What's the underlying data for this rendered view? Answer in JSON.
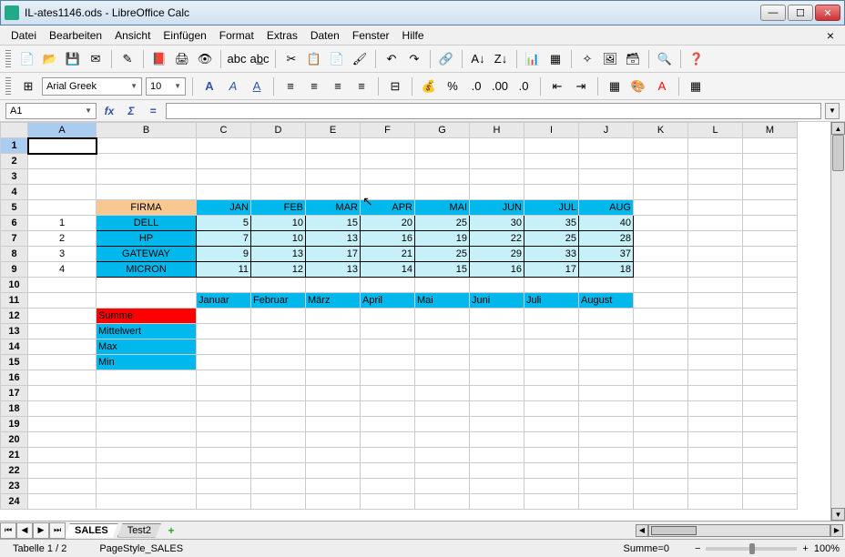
{
  "window": {
    "title": "IL-ates1146.ods - LibreOffice Calc"
  },
  "menu": {
    "items": [
      "Datei",
      "Bearbeiten",
      "Ansicht",
      "Einfügen",
      "Format",
      "Extras",
      "Daten",
      "Fenster",
      "Hilfe"
    ]
  },
  "font": {
    "name": "Arial Greek",
    "size": "10"
  },
  "cellref": "A1",
  "columns": [
    "A",
    "B",
    "C",
    "D",
    "E",
    "F",
    "G",
    "H",
    "I",
    "J",
    "K",
    "L",
    "M"
  ],
  "table": {
    "firma_label": "FIRMA",
    "months": [
      "JAN",
      "FEB",
      "MAR",
      "APR",
      "MAI",
      "JUN",
      "JUL",
      "AUG"
    ],
    "rows": [
      {
        "n": "1",
        "company": "DELL",
        "vals": [
          "5",
          "10",
          "15",
          "20",
          "25",
          "30",
          "35",
          "40"
        ]
      },
      {
        "n": "2",
        "company": "HP",
        "vals": [
          "7",
          "10",
          "13",
          "16",
          "19",
          "22",
          "25",
          "28"
        ]
      },
      {
        "n": "3",
        "company": "GATEWAY",
        "vals": [
          "9",
          "13",
          "17",
          "21",
          "25",
          "29",
          "33",
          "37"
        ]
      },
      {
        "n": "4",
        "company": "MICRON",
        "vals": [
          "11",
          "12",
          "13",
          "14",
          "15",
          "16",
          "17",
          "18"
        ]
      }
    ],
    "months_long": [
      "Januar",
      "Februar",
      "März",
      "April",
      "Mai",
      "Juni",
      "Juli",
      "August"
    ],
    "stats": [
      "Summe",
      "Mittelwert",
      "Max",
      "Min"
    ]
  },
  "tabs": {
    "items": [
      "SALES",
      "Test2"
    ],
    "active": 0
  },
  "status": {
    "sheet": "Tabelle 1 / 2",
    "style": "PageStyle_SALES",
    "sum": "Summe=0",
    "zoom": "100%"
  },
  "chart_data": {
    "type": "table",
    "categories": [
      "JAN",
      "FEB",
      "MAR",
      "APR",
      "MAI",
      "JUN",
      "JUL",
      "AUG"
    ],
    "series": [
      {
        "name": "DELL",
        "values": [
          5,
          10,
          15,
          20,
          25,
          30,
          35,
          40
        ]
      },
      {
        "name": "HP",
        "values": [
          7,
          10,
          13,
          16,
          19,
          22,
          25,
          28
        ]
      },
      {
        "name": "GATEWAY",
        "values": [
          9,
          13,
          17,
          21,
          25,
          29,
          33,
          37
        ]
      },
      {
        "name": "MICRON",
        "values": [
          11,
          12,
          13,
          14,
          15,
          16,
          17,
          18
        ]
      }
    ]
  }
}
